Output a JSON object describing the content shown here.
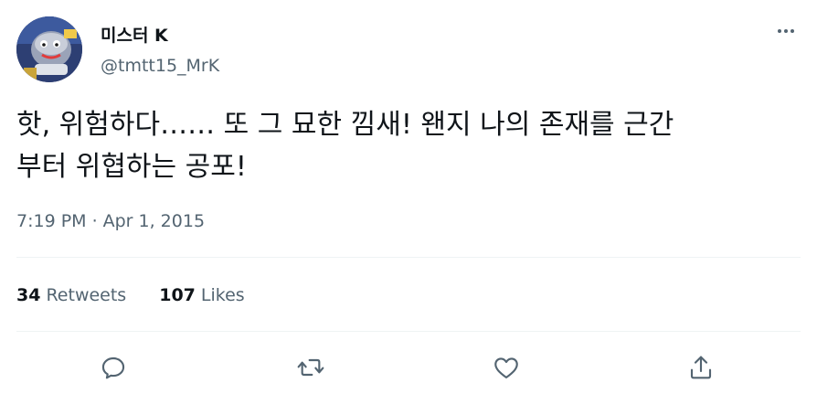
{
  "tweet": {
    "author": {
      "display_name": "미스터 K",
      "handle": "@tmtt15_MrK"
    },
    "text": "핫, 위험하다…… 또 그 묘한 낌새! 왠지 나의 존재를 근간\n부터 위협하는 공포!",
    "time": "7:19 PM",
    "separator": "·",
    "date": "Apr 1, 2015",
    "stats": {
      "retweets_count": "34",
      "retweets_label": "Retweets",
      "likes_count": "107",
      "likes_label": "Likes"
    },
    "icons": {
      "more": "more-horizontal-icon",
      "reply": "reply-icon",
      "retweet": "retweet-icon",
      "like": "heart-icon",
      "share": "share-icon"
    },
    "colors": {
      "text_primary": "#0f1419",
      "text_secondary": "#536471",
      "divider": "#eff3f4"
    }
  }
}
